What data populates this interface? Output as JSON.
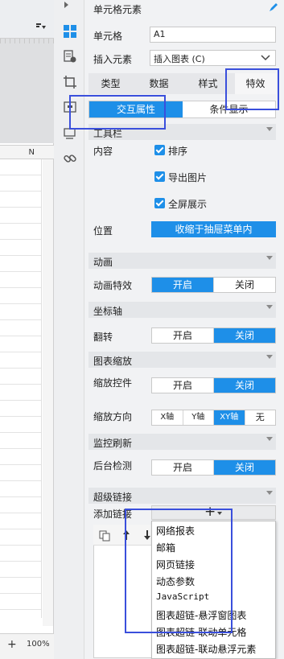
{
  "sheet": {
    "column_header": "N",
    "zoom": "100%",
    "zoom_plus": "+"
  },
  "panel": {
    "title": "单元格元素",
    "cell_label": "单元格",
    "cell_value": "A1",
    "insert_label": "插入元素",
    "insert_value": "插入图表 (C)",
    "tabs": [
      "类型",
      "数据",
      "样式",
      "特效"
    ],
    "subtabs": [
      "交互属性",
      "条件显示"
    ],
    "toolbar_section": "工具栏",
    "content_label": "内容",
    "checkbox_sort": "排序",
    "checkbox_export": "导出图片",
    "checkbox_fullscreen": "全屏展示",
    "position_label": "位置",
    "position_value": "收缩于抽屉菜单内",
    "animation_section": "动画",
    "animation_effect_label": "动画特效",
    "axis_section": "坐标轴",
    "flip_label": "翻转",
    "zoom_section": "图表缩放",
    "zoom_control_label": "缩放控件",
    "zoom_direction_label": "缩放方向",
    "dir_options": [
      "X轴",
      "Y轴",
      "XY轴",
      "无"
    ],
    "monitor_section": "监控刷新",
    "background_check_label": "后台检测",
    "on_label": "开启",
    "off_label": "关闭",
    "hyperlink_section": "超级链接",
    "add_link_label": "添加链接",
    "add_plus": "+"
  },
  "link_menu": [
    "网络报表",
    "邮箱",
    "网页链接",
    "动态参数",
    "JavaScript",
    "图表超链-悬浮窗图表",
    "图表超链-联动单元格",
    "图表超链-联动悬浮元素"
  ],
  "colors": {
    "accent": "#1e8fe8",
    "highlight_box": "#3a4fdc"
  }
}
